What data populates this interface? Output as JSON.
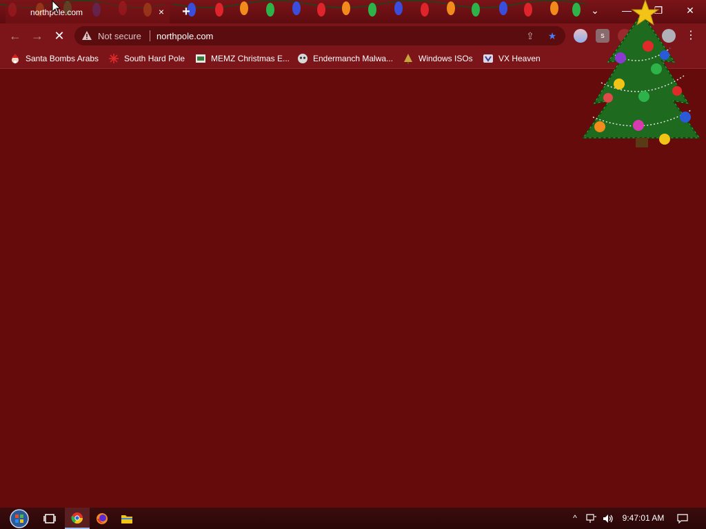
{
  "tab": {
    "title": "northpole.com",
    "close_glyph": "×",
    "new_tab_glyph": "+"
  },
  "window_controls": {
    "tab_search_glyph": "⌄",
    "minimize_glyph": "—",
    "restore_glyph": "❐",
    "close_glyph": "✕"
  },
  "toolbar": {
    "back_glyph": "←",
    "forward_glyph": "→",
    "stop_glyph": "✕",
    "security_label": "Not secure",
    "url": "northpole.com",
    "share_glyph": "⇪",
    "star_glyph": "★",
    "ext_s_label": "s",
    "menu_glyph": "⋮"
  },
  "bookmarks": [
    {
      "label": "Santa Bombs Arabs",
      "icon": "santa-icon"
    },
    {
      "label": "South Hard Pole",
      "icon": "snowflake-icon"
    },
    {
      "label": "MEMZ Christmas E...",
      "icon": "memz-icon"
    },
    {
      "label": "Endermanch Malwa...",
      "icon": "endermanch-icon"
    },
    {
      "label": "Windows ISOs",
      "icon": "tree-small-icon"
    },
    {
      "label": "VX Heaven",
      "icon": "vx-icon"
    }
  ],
  "taskbar": {
    "clock": "9:47:01 AM",
    "tray_up_glyph": "^",
    "apps": [
      "start-orb",
      "task-view",
      "chrome",
      "firefox",
      "file-explorer"
    ]
  },
  "colors": {
    "page_bg": "#650b0b",
    "chrome_bg": "#7b1519",
    "omnibox_bg": "#5a0c0f",
    "star_accent": "#4a7cf5"
  }
}
